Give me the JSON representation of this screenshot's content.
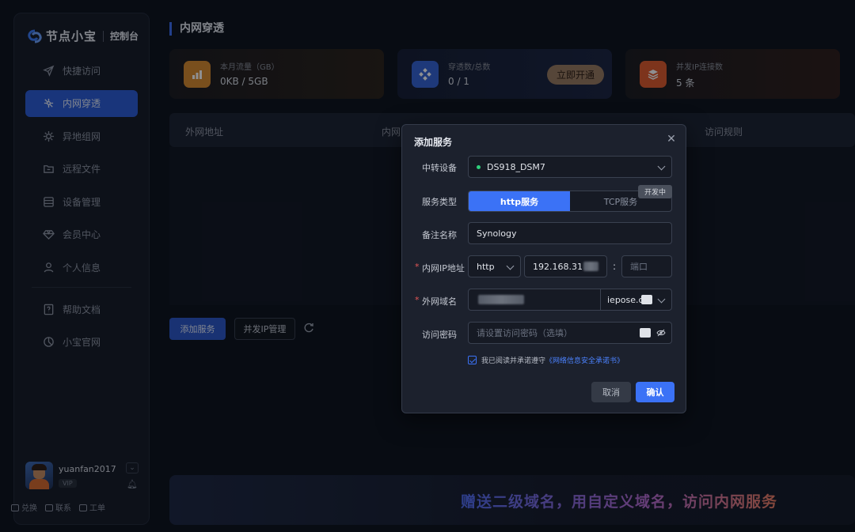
{
  "brand": {
    "name": "节点小宝",
    "sub": "控制台"
  },
  "sidebar": {
    "items": [
      {
        "label": "快捷访问",
        "icon": "send-icon"
      },
      {
        "label": "内网穿透",
        "icon": "network-icon",
        "active": true
      },
      {
        "label": "异地组网",
        "icon": "gear-network-icon"
      },
      {
        "label": "远程文件",
        "icon": "folder-icon"
      },
      {
        "label": "设备管理",
        "icon": "device-icon"
      },
      {
        "label": "会员中心",
        "icon": "diamond-icon"
      },
      {
        "label": "个人信息",
        "icon": "user-icon"
      }
    ],
    "items2": [
      {
        "label": "帮助文档",
        "icon": "help-doc-icon"
      },
      {
        "label": "小宝官网",
        "icon": "website-icon"
      }
    ],
    "user": {
      "name": "yuanfan2017",
      "badge": "VIP"
    },
    "footer": [
      "兑换",
      "联系",
      "工单"
    ]
  },
  "main": {
    "title": "内网穿透",
    "stats": [
      {
        "label": "本月流量（GB）",
        "value": "0KB / 5GB"
      },
      {
        "label": "穿透数/总数",
        "value": "0 / 1",
        "button": "立即开通"
      },
      {
        "label": "并发IP连接数",
        "value": "5 条"
      }
    ],
    "table_headers": [
      "外网地址",
      "内网",
      "访问规则"
    ],
    "actions": {
      "add": "添加服务",
      "ip": "并发IP管理"
    },
    "banner": "赠送二级域名，用自定义域名，访问内网服务"
  },
  "dialog": {
    "title": "添加服务",
    "relay_label": "中转设备",
    "relay_value": "DS918_DSM7",
    "type_label": "服务类型",
    "type_options": [
      "http服务",
      "TCP服务"
    ],
    "type_badge": "开发中",
    "note_label": "备注名称",
    "note_value": "Synology",
    "ip_label": "内网IP地址",
    "ip_protocol": "http",
    "ip_value": "192.168.31",
    "ip_sep": ":",
    "port_placeholder": "端口",
    "domain_label": "外网域名",
    "domain_suffix": "iepose.c",
    "pw_label": "访问密码",
    "pw_placeholder": "请设置访问密码（选填）",
    "agree_text": "我已阅读并承诺遵守",
    "agree_link": "《网络信息安全承诺书》",
    "cancel": "取消",
    "confirm": "确认"
  },
  "colors": {
    "accent": "#3b72f6",
    "active_nav": "#2b5bd7",
    "status_dot": "#2fcf7c"
  }
}
